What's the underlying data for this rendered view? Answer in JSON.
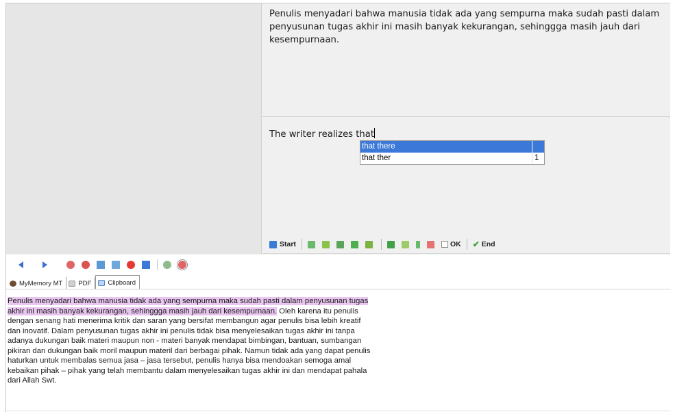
{
  "source": {
    "text": "Penulis menyadari bahwa manusia tidak ada yang sempurna maka sudah pasti dalam penyusunan tugas akhir ini masih banyak kekurangan, sehinggga masih jauh dari kesempurnaan."
  },
  "target": {
    "text": "The writer realizes that"
  },
  "autocomplete": {
    "items": [
      {
        "text": "that there",
        "count": ""
      },
      {
        "text": "that ther",
        "count": "1"
      }
    ]
  },
  "toolbar": {
    "start_label": "Start",
    "ok_label": "OK",
    "end_label": "End"
  },
  "tabs": [
    {
      "label": "MyMemory MT"
    },
    {
      "label": "PDF"
    },
    {
      "label": "Clipboard"
    }
  ],
  "clipboard": {
    "highlighted": "Penulis menyadari bahwa manusia tidak ada yang sempurna maka sudah pasti dalam penyusunan tugas akhir ini masih banyak kekurangan, sehinggga masih jauh dari kesempurnaan.",
    "rest": " Oleh karena itu penulis dengan senang hati menerima kritik dan saran yang bersifat membangun agar penulis bisa lebih kreatif dan inovatif. Dalam penyusunan tugas akhir ini penulis tidak bisa menyelesaikan tugas akhir ini tanpa adanya dukungan baik materi maupun non - materi banyak mendapat bimbingan, bantuan, sumbangan pikiran dan dukungan baik moril maupun materil dari berbagai pihak. Namun tidak ada yang dapat penulis haturkan untuk membalas semua jasa – jasa tersebut, penulis hanya bisa mendoakan semoga amal kebaikan pihak – pihak yang telah membantu dalam menyelesaikan tugas akhir ini dan mendapat pahala dari Allah Swt."
  },
  "colors": {
    "highlight": "#e8c6ef",
    "selection": "#3b78d8",
    "nav_arrow": "#3b6fd0"
  }
}
